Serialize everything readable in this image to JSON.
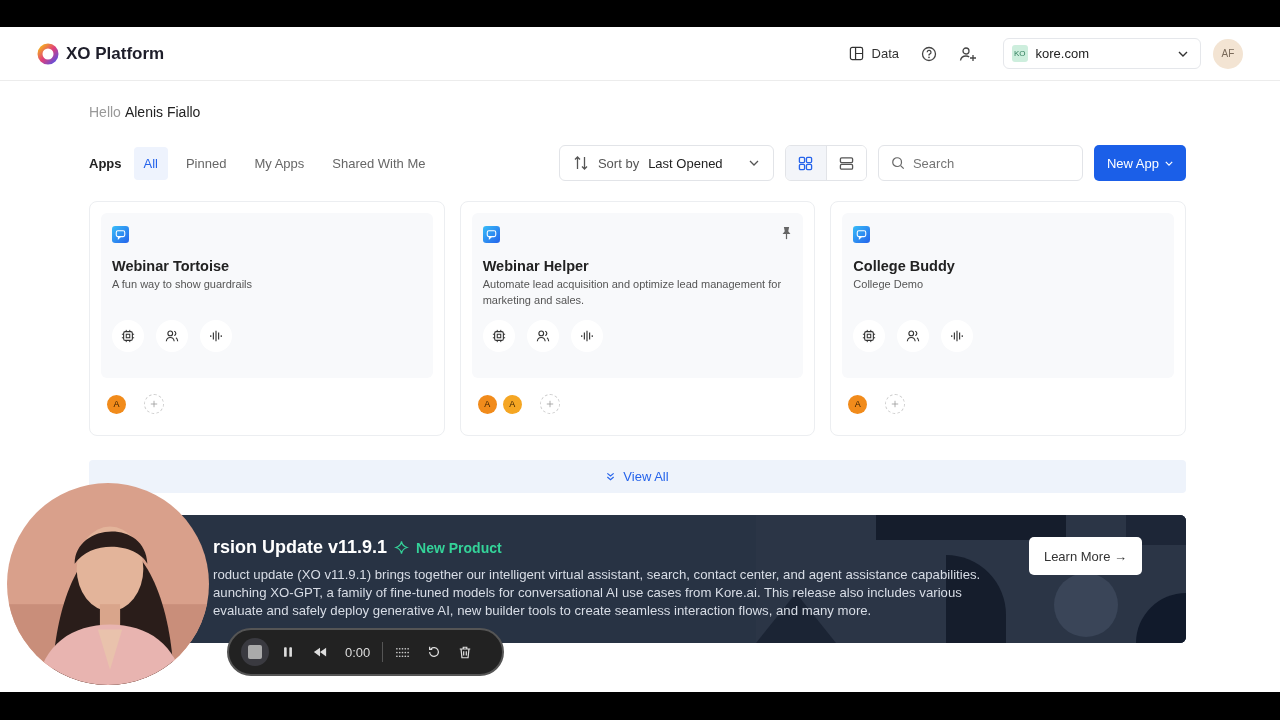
{
  "header": {
    "logo": "XO Platform",
    "data_link": "Data",
    "workspace": {
      "badge": "KO",
      "name": "kore.com"
    },
    "avatar": "AF"
  },
  "greeting": {
    "hello": "Hello",
    "name": "Alenis Fiallo"
  },
  "apps_label": "Apps",
  "tabs": [
    {
      "label": "All",
      "selected": true
    },
    {
      "label": "Pinned",
      "selected": false
    },
    {
      "label": "My Apps",
      "selected": false
    },
    {
      "label": "Shared With Me",
      "selected": false
    }
  ],
  "sort": {
    "label": "Sort by",
    "value": "Last Opened"
  },
  "views": [
    {
      "kind": "grid",
      "selected": true
    },
    {
      "kind": "list",
      "selected": false
    }
  ],
  "search": {
    "placeholder": "Search"
  },
  "new_app": "New App",
  "cards": [
    {
      "title": "Webinar Tortoise",
      "description": "A fun way to show guardrails",
      "pinned": false,
      "members": [
        "A"
      ]
    },
    {
      "title": "Webinar Helper",
      "description": "Automate lead acquisition and optimize lead management for marketing and sales.",
      "pinned": true,
      "members": [
        "A",
        "A"
      ]
    },
    {
      "title": "College Buddy",
      "description": "College Demo",
      "pinned": false,
      "members": [
        "A"
      ]
    }
  ],
  "view_all": "View All",
  "banner": {
    "title": "rsion Update v11.9.1",
    "tag": "New Product",
    "lines": [
      "roduct update (XO v11.9.1) brings together our intelligent virtual assistant, search, contact center, and agent assistance capabilities.",
      "aunching XO-GPT, a family of fine-tuned models for conversational AI use cases from Kore.ai. This release also includes various",
      "evaluate and safely deploy generative AI, new builder tools to create seamless interaction flows, and many more."
    ],
    "button": "Learn More →"
  },
  "recorder": {
    "time": "0:00"
  }
}
